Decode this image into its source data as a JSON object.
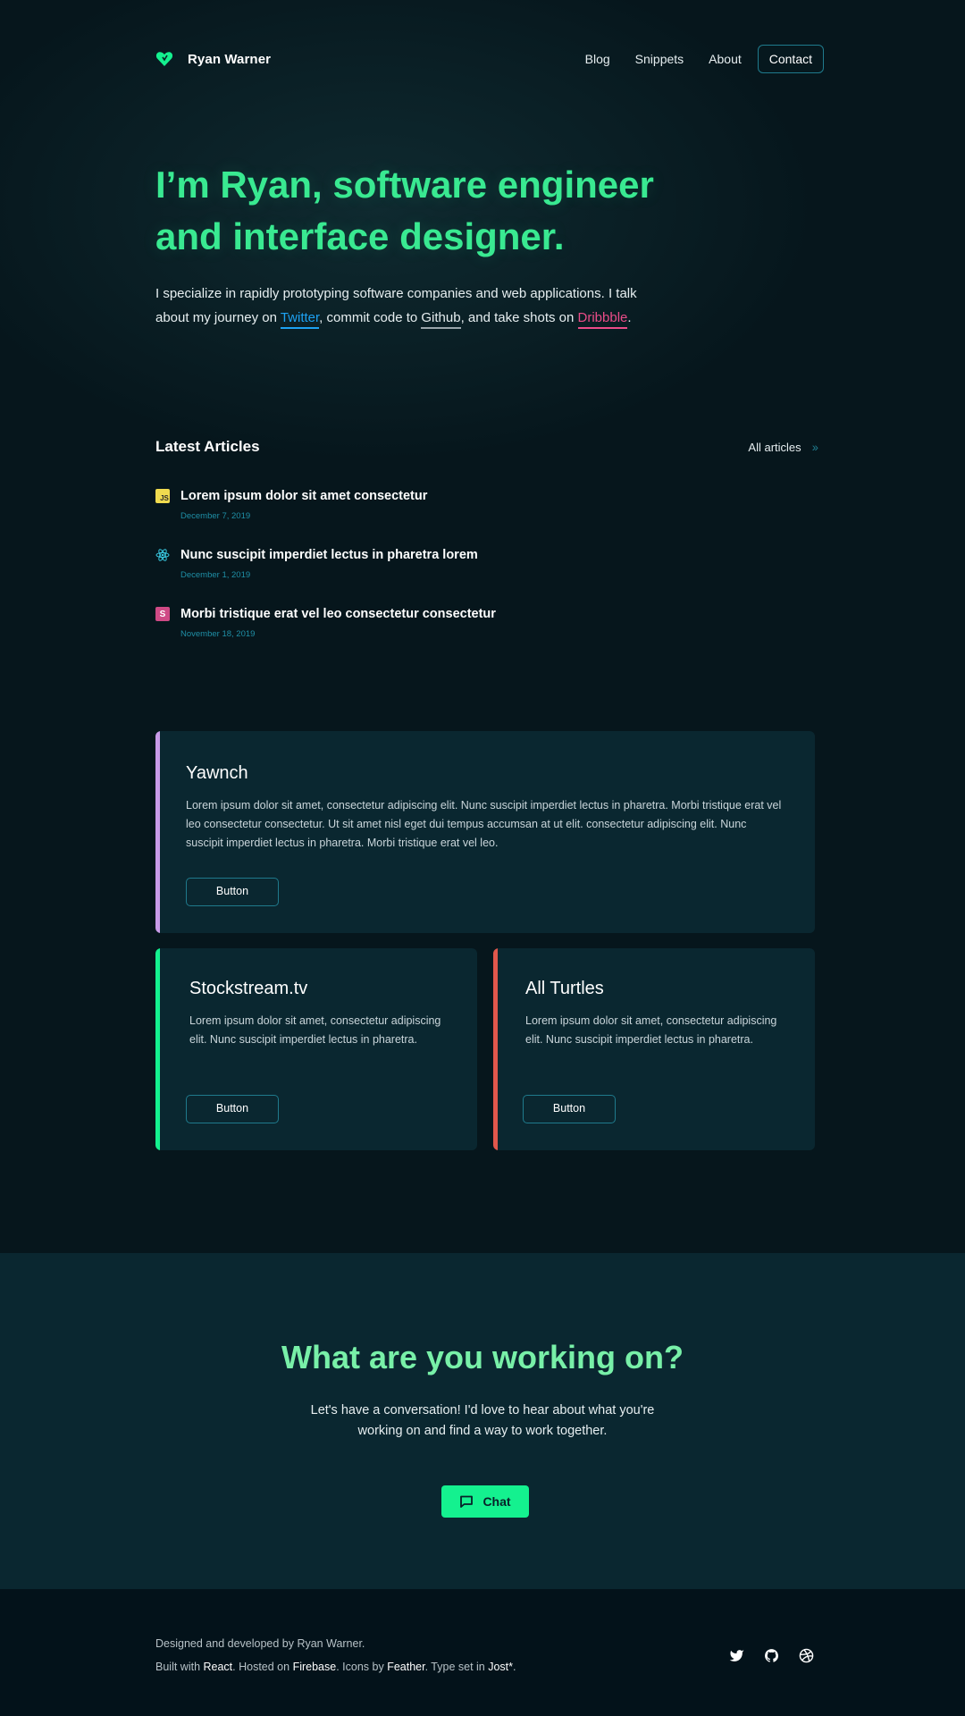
{
  "nav": {
    "brand": "Ryan Warner",
    "links": [
      "Blog",
      "Snippets",
      "About"
    ],
    "contact": "Contact"
  },
  "hero": {
    "title_line1": "I’m Ryan, software engineer",
    "title_line2": "and interface designer.",
    "t1": "I specialize in rapidly prototyping software companies and web applications. I talk about my journey on ",
    "twitter": "Twitter",
    "t2": ", commit code to ",
    "github": "Github",
    "t3": ", and take shots on ",
    "dribbble": "Dribbble",
    "t4": "."
  },
  "articles": {
    "heading": "Latest Articles",
    "all": "All articles",
    "items": [
      {
        "icon": "js-icon",
        "label": "JS",
        "title": "Lorem ipsum dolor sit amet consectetur",
        "date": "December 7, 2019"
      },
      {
        "icon": "react-icon",
        "label": "",
        "title": "Nunc suscipit imperdiet lectus in pharetra lorem",
        "date": "December 1, 2019"
      },
      {
        "icon": "sass-icon",
        "label": "S",
        "title": "Morbi tristique erat vel leo consectetur consectetur",
        "date": "November 18, 2019"
      }
    ]
  },
  "projects": [
    {
      "title": "Yawnch",
      "text": "Lorem ipsum dolor sit amet, consectetur adipiscing elit. Nunc suscipit imperdiet lectus in pharetra. Morbi tristique erat vel leo consectetur consectetur. Ut sit amet nisl eget dui tempus accumsan at ut elit. consectetur adipiscing elit. Nunc suscipit imperdiet lectus in pharetra. Morbi tristique erat vel leo.",
      "button": "Button",
      "accent": "#c89be8"
    },
    {
      "title": "Stockstream.tv",
      "text": "Lorem ipsum dolor sit amet, consectetur adipiscing elit. Nunc suscipit imperdiet lectus in pharetra.",
      "button": "Button",
      "accent": "#14f18f"
    },
    {
      "title": "All Turtles",
      "text": "Lorem ipsum dolor sit amet, consectetur adipiscing elit. Nunc suscipit imperdiet lectus in pharetra.",
      "button": "Button",
      "accent": "#e2574c"
    }
  ],
  "cta": {
    "title": "What are you working on?",
    "text": "Let's have a conversation! I'd love to hear about what you're working on and find a way to work together.",
    "button": "Chat"
  },
  "footer": {
    "line1": "Designed and developed by Ryan Warner.",
    "built": "Built with ",
    "react": "React",
    "hosted": ". Hosted on ",
    "firebase": "Firebase",
    "icons": ". Icons by ",
    "feather": "Feather",
    "type": ". Type set in ",
    "jost": "Jost*",
    "end": "."
  },
  "colors": {
    "accent_green": "#39e991",
    "twitter": "#1da1f2",
    "dribbble": "#ea4c89",
    "card_bg": "#0a2730",
    "button_border": "#1f7a8c"
  }
}
